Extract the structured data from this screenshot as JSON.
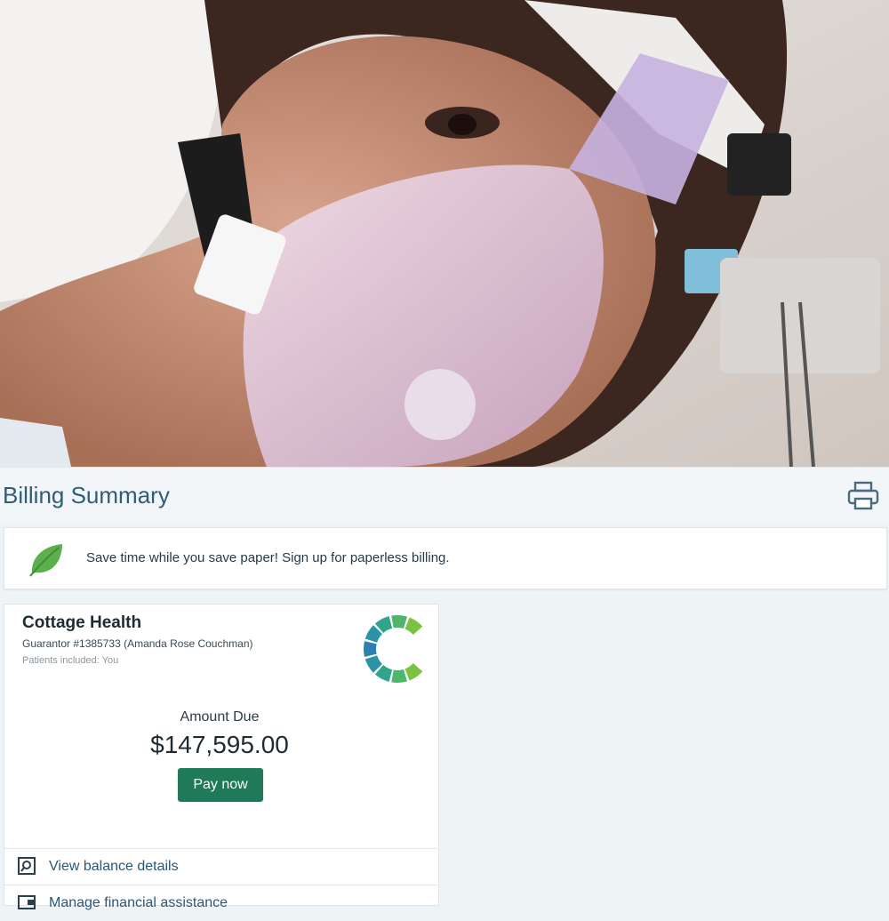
{
  "billing": {
    "title": "Billing Summary",
    "print_icon": "printer-icon",
    "banner": {
      "icon": "leaf-icon",
      "text": "Save time while you save paper! Sign up for paperless billing."
    },
    "account": {
      "organization": "Cottage Health",
      "guarantor": "Guarantor #1385733 (Amanda Rose Couchman)",
      "patients": "Patients included: You",
      "logo": "cottage-health-logo",
      "amount_label": "Amount Due",
      "amount_value": "$147,595.00",
      "pay_label": "Pay now",
      "links": [
        {
          "label": "View balance details",
          "icon": "search-document-icon"
        },
        {
          "label": "Manage financial assistance",
          "icon": "wallet-icon"
        }
      ]
    }
  },
  "colors": {
    "title": "#2f5d78",
    "pay_button": "#1f7a57",
    "link": "#2a5777",
    "leaf": "#5bb04c"
  }
}
